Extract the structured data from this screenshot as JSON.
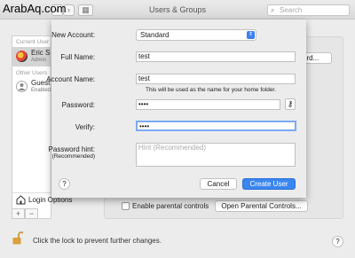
{
  "watermark": "ArabAq.com",
  "window": {
    "title": "Users & Groups",
    "search_placeholder": "Search"
  },
  "sidebar": {
    "current_header": "Current User",
    "other_header": "Other Users",
    "users": [
      {
        "name": "Eric S",
        "sub": "Admin"
      },
      {
        "name": "Guest",
        "sub": "Enabled"
      }
    ],
    "login_options": "Login Options"
  },
  "background": {
    "password_button": "ord...",
    "parental_controls_label": "Enable parental controls",
    "open_parental_button": "Open Parental Controls..."
  },
  "sheet": {
    "new_account_label": "New Account:",
    "new_account_value": "Standard",
    "full_name_label": "Full Name:",
    "full_name_value": "test",
    "account_name_label": "Account Name:",
    "account_name_value": "test",
    "account_name_hint": "This will be used as the name for your home folder.",
    "password_label": "Password:",
    "password_value": "••••",
    "verify_label": "Verify:",
    "verify_value": "••••",
    "hint_label": "Password hint:",
    "hint_sub": "(Recommended)",
    "hint_placeholder": "Hint (Recommended)",
    "cancel_label": "Cancel",
    "create_label": "Create User",
    "help": "?"
  },
  "bottom": {
    "lock_text": "Click the lock to prevent further changes.",
    "help": "?"
  },
  "colors": {
    "accent": "#3a86f0",
    "focus_ring": "#7aaaf5"
  }
}
